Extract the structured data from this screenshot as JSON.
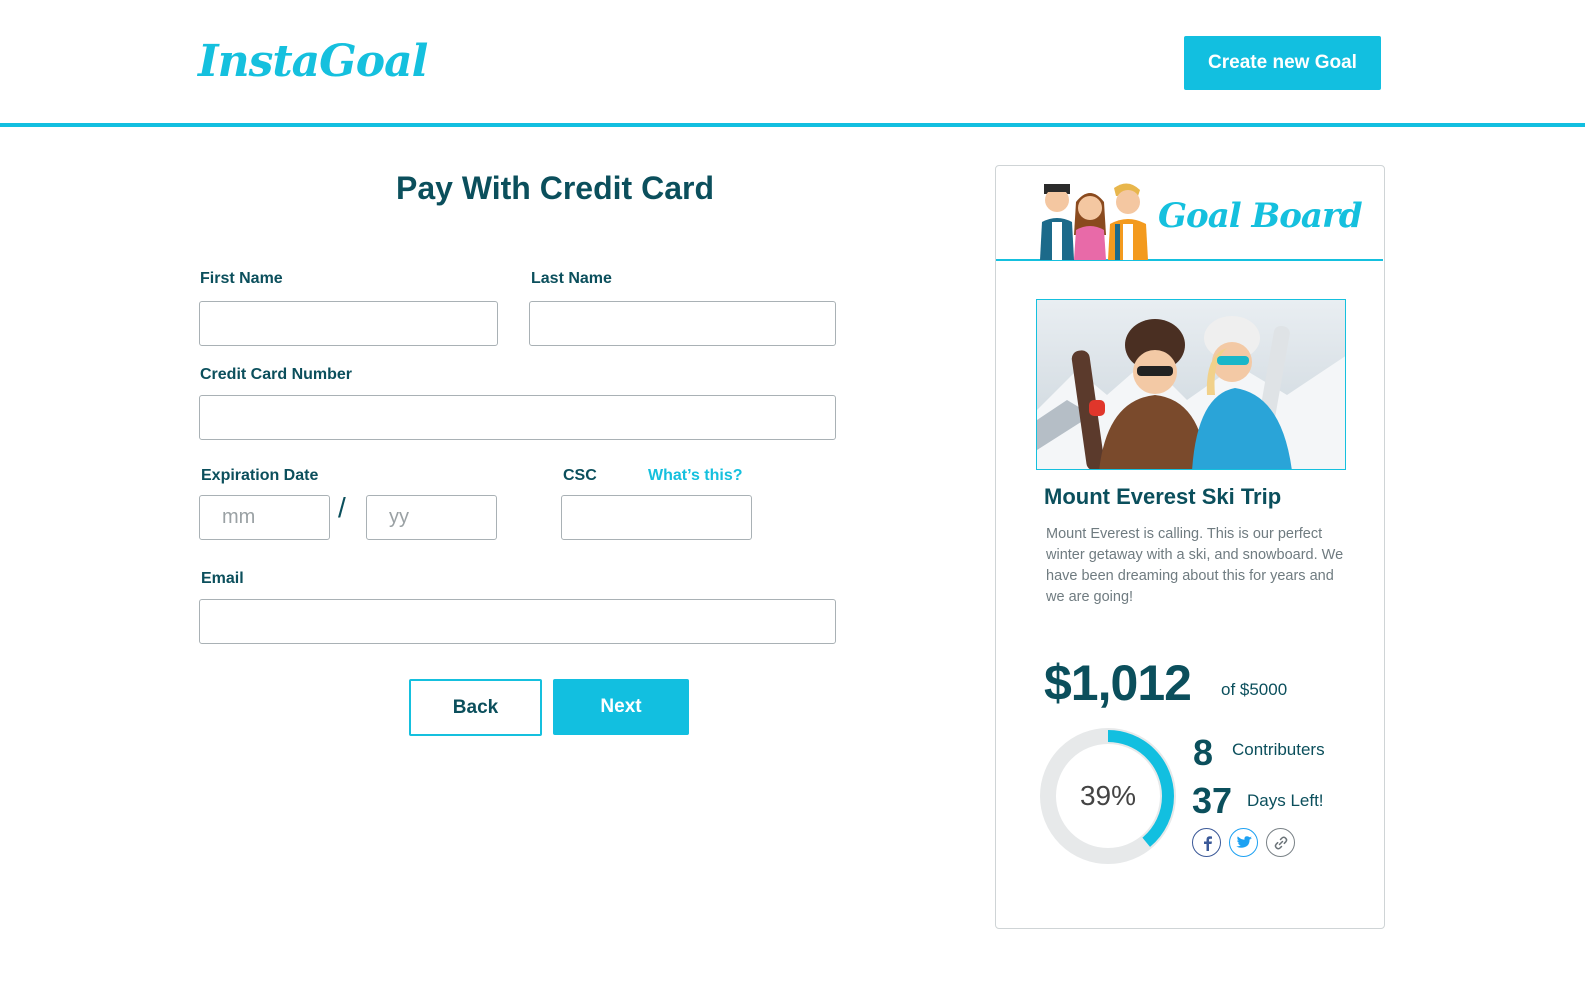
{
  "header": {
    "logo": "InstaGoal",
    "create_button": "Create new Goal"
  },
  "form": {
    "title": "Pay With Credit Card",
    "first_name_label": "First Name",
    "last_name_label": "Last Name",
    "card_number_label": "Credit Card Number",
    "expiration_label": "Expiration Date",
    "month_placeholder": "mm",
    "year_placeholder": "yy",
    "date_separator": "/",
    "csc_label": "CSC",
    "whats_this": "What’s this?",
    "email_label": "Email",
    "back_button": "Back",
    "next_button": "Next"
  },
  "goal_board": {
    "title": "Goal Board",
    "goal_title": "Mount Everest Ski Trip",
    "goal_description": "Mount Everest is calling. This is our perfect winter getaway with a ski, and snowboard. We have been dreaming about this for years and we are going!",
    "raised": "$1,012",
    "of_target": "of $5000",
    "progress_percent": 39,
    "progress_label": "39%",
    "contributors_count": "8",
    "contributors_label": "Contributers",
    "days_left_count": "37",
    "days_left_label": "Days Left!",
    "share_icons": [
      "facebook-icon",
      "twitter-icon",
      "link-icon"
    ]
  },
  "colors": {
    "accent": "#12bfe0",
    "primary_text": "#0b4f5c",
    "muted_text": "#6f7b80",
    "facebook": "#3b5998",
    "twitter": "#1da1f2"
  }
}
